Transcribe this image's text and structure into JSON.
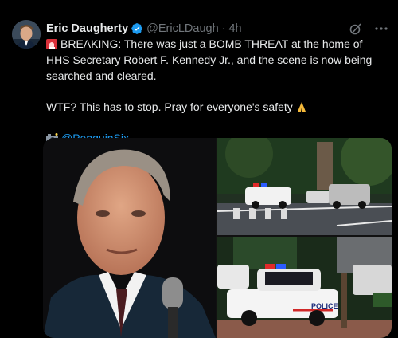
{
  "tweet": {
    "author_name": "Eric Daugherty",
    "handle": "@EricLDaugh",
    "separator": "·",
    "time": "4h",
    "verified_color": "#1d9bf0",
    "line1": "BREAKING: There was just a BOMB THREAT at the home of HHS Secretary Robert F. Kennedy Jr., and the scene is now being searched and cleared.",
    "line2": "WTF? This has to stop. Pray for everyone's safety",
    "mention": "@PenguinSix",
    "icons": {
      "siren": "siren-emoji-icon",
      "pray": "folded-hands-emoji-icon",
      "camera": "camera-emoji-icon",
      "grok": "grok-icon",
      "more": "more-icon"
    }
  },
  "media": {
    "photo_count": 3,
    "photo3_sign": "POLICE"
  }
}
